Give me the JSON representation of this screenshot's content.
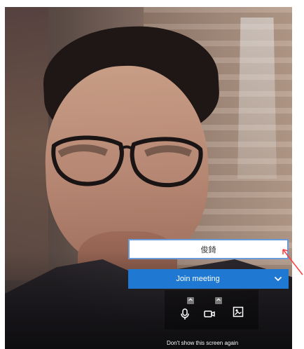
{
  "join_screen": {
    "name_value": "俊錡",
    "join_button_label": "Join meeting",
    "dont_show_label": "Don't show this screen again"
  },
  "icons": {
    "microphone": "microphone-icon",
    "camera": "camera-icon",
    "background": "background-effects-icon",
    "chevron": "chevron-down-icon",
    "caret": "caret-up-icon"
  },
  "colors": {
    "primary_button": "#1f78d1",
    "input_border": "#6a9ad8",
    "annotation": "#ff3b3b"
  }
}
